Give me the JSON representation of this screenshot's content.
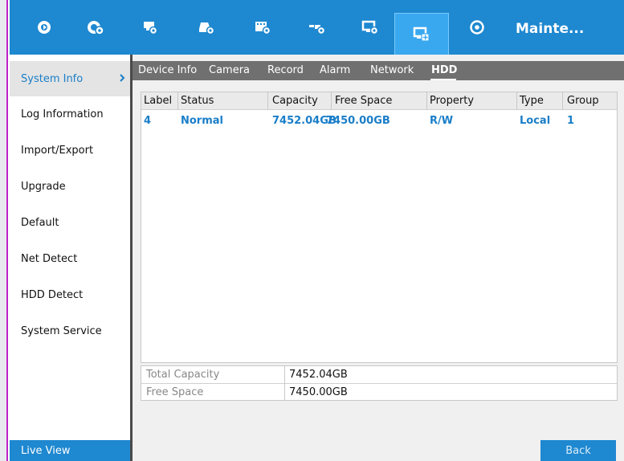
{
  "topbar": {
    "items": [
      {
        "icon": "playback-icon"
      },
      {
        "icon": "camera-settings-icon"
      },
      {
        "icon": "record-settings-icon"
      },
      {
        "icon": "storage-settings-icon"
      },
      {
        "icon": "film-settings-icon"
      },
      {
        "icon": "network-settings-icon"
      },
      {
        "icon": "monitor-settings-icon"
      },
      {
        "icon": "maintenance-icon"
      },
      {
        "icon": "power-icon"
      }
    ],
    "title": "Mainte...",
    "accent": "#1e88d0"
  },
  "sidebar": {
    "items": [
      {
        "label": "System Info"
      },
      {
        "label": "Log Information"
      },
      {
        "label": "Import/Export"
      },
      {
        "label": "Upgrade"
      },
      {
        "label": "Default"
      },
      {
        "label": "Net Detect"
      },
      {
        "label": "HDD Detect"
      },
      {
        "label": "System Service"
      }
    ],
    "live_view": "Live View"
  },
  "tabs": [
    {
      "label": "Device Info"
    },
    {
      "label": "Camera"
    },
    {
      "label": "Record"
    },
    {
      "label": "Alarm"
    },
    {
      "label": "Network"
    },
    {
      "label": "HDD"
    }
  ],
  "hdd_table": {
    "columns": [
      "Label",
      "Status",
      "Capacity",
      "Free Space",
      "Property",
      "Type",
      "Group"
    ],
    "rows": [
      [
        "4",
        "Normal",
        "7452.04GB",
        "7450.00GB",
        "R/W",
        "Local",
        "1"
      ]
    ]
  },
  "summary": {
    "total_capacity_label": "Total Capacity",
    "total_capacity_value": "7452.04GB",
    "free_space_label": "Free Space",
    "free_space_value": "7450.00GB"
  },
  "back_label": "Back"
}
